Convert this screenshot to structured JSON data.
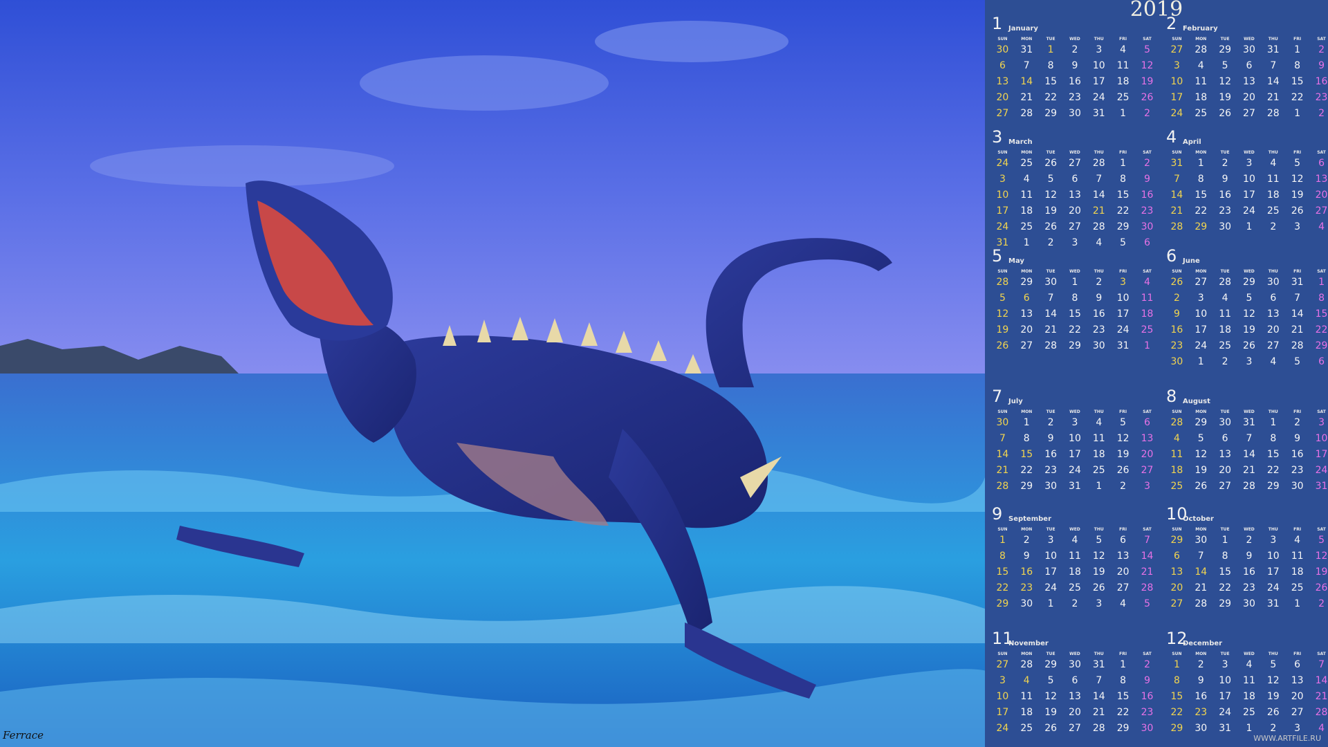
{
  "year": "2019",
  "weekdays": [
    "SUN",
    "MON",
    "TUE",
    "WED",
    "THU",
    "FRI",
    "SAT"
  ],
  "watermark": "WWW.ARTFILE.RU",
  "signature": "Ferrace",
  "colors": {
    "panel": "#2d4e94",
    "sunday": "#f2d54f",
    "saturday": "#e772e6",
    "text": "#f6f6f6"
  },
  "months": [
    {
      "num": "1",
      "name": "January",
      "weeks": [
        [
          "30",
          "31",
          "1",
          "2",
          "3",
          "4",
          "5"
        ],
        [
          "6",
          "7",
          "8",
          "9",
          "10",
          "11",
          "12"
        ],
        [
          "13",
          "14",
          "15",
          "16",
          "17",
          "18",
          "19"
        ],
        [
          "20",
          "21",
          "22",
          "23",
          "24",
          "25",
          "26"
        ],
        [
          "27",
          "28",
          "29",
          "30",
          "31",
          "1",
          "2"
        ]
      ],
      "holidays": [
        "0:2",
        "2:1"
      ]
    },
    {
      "num": "2",
      "name": "February",
      "weeks": [
        [
          "27",
          "28",
          "29",
          "30",
          "31",
          "1",
          "2"
        ],
        [
          "3",
          "4",
          "5",
          "6",
          "7",
          "8",
          "9"
        ],
        [
          "10",
          "11",
          "12",
          "13",
          "14",
          "15",
          "16"
        ],
        [
          "17",
          "18",
          "19",
          "20",
          "21",
          "22",
          "23"
        ],
        [
          "24",
          "25",
          "26",
          "27",
          "28",
          "1",
          "2"
        ]
      ],
      "holidays": []
    },
    {
      "num": "3",
      "name": "March",
      "weeks": [
        [
          "24",
          "25",
          "26",
          "27",
          "28",
          "1",
          "2"
        ],
        [
          "3",
          "4",
          "5",
          "6",
          "7",
          "8",
          "9"
        ],
        [
          "10",
          "11",
          "12",
          "13",
          "14",
          "15",
          "16"
        ],
        [
          "17",
          "18",
          "19",
          "20",
          "21",
          "22",
          "23"
        ],
        [
          "24",
          "25",
          "26",
          "27",
          "28",
          "29",
          "30"
        ],
        [
          "31",
          "1",
          "2",
          "3",
          "4",
          "5",
          "6"
        ]
      ],
      "holidays": [
        "3:4"
      ]
    },
    {
      "num": "4",
      "name": "April",
      "weeks": [
        [
          "31",
          "1",
          "2",
          "3",
          "4",
          "5",
          "6"
        ],
        [
          "7",
          "8",
          "9",
          "10",
          "11",
          "12",
          "13"
        ],
        [
          "14",
          "15",
          "16",
          "17",
          "18",
          "19",
          "20"
        ],
        [
          "21",
          "22",
          "23",
          "24",
          "25",
          "26",
          "27"
        ],
        [
          "28",
          "29",
          "30",
          "1",
          "2",
          "3",
          "4"
        ]
      ],
      "holidays": [
        "4:1"
      ]
    },
    {
      "num": "5",
      "name": "May",
      "weeks": [
        [
          "28",
          "29",
          "30",
          "1",
          "2",
          "3",
          "4"
        ],
        [
          "5",
          "6",
          "7",
          "8",
          "9",
          "10",
          "11"
        ],
        [
          "12",
          "13",
          "14",
          "15",
          "16",
          "17",
          "18"
        ],
        [
          "19",
          "20",
          "21",
          "22",
          "23",
          "24",
          "25"
        ],
        [
          "26",
          "27",
          "28",
          "29",
          "30",
          "31",
          "1"
        ]
      ],
      "holidays": [
        "0:5",
        "1:1"
      ]
    },
    {
      "num": "6",
      "name": "June",
      "weeks": [
        [
          "26",
          "27",
          "28",
          "29",
          "30",
          "31",
          "1"
        ],
        [
          "2",
          "3",
          "4",
          "5",
          "6",
          "7",
          "8"
        ],
        [
          "9",
          "10",
          "11",
          "12",
          "13",
          "14",
          "15"
        ],
        [
          "16",
          "17",
          "18",
          "19",
          "20",
          "21",
          "22"
        ],
        [
          "23",
          "24",
          "25",
          "26",
          "27",
          "28",
          "29"
        ],
        [
          "30",
          "1",
          "2",
          "3",
          "4",
          "5",
          "6"
        ]
      ],
      "holidays": []
    },
    {
      "num": "7",
      "name": "July",
      "weeks": [
        [
          "30",
          "1",
          "2",
          "3",
          "4",
          "5",
          "6"
        ],
        [
          "7",
          "8",
          "9",
          "10",
          "11",
          "12",
          "13"
        ],
        [
          "14",
          "15",
          "16",
          "17",
          "18",
          "19",
          "20"
        ],
        [
          "21",
          "22",
          "23",
          "24",
          "25",
          "26",
          "27"
        ],
        [
          "28",
          "29",
          "30",
          "31",
          "1",
          "2",
          "3"
        ]
      ],
      "holidays": [
        "2:1"
      ]
    },
    {
      "num": "8",
      "name": "August",
      "weeks": [
        [
          "28",
          "29",
          "30",
          "31",
          "1",
          "2",
          "3"
        ],
        [
          "4",
          "5",
          "6",
          "7",
          "8",
          "9",
          "10"
        ],
        [
          "11",
          "12",
          "13",
          "14",
          "15",
          "16",
          "17"
        ],
        [
          "18",
          "19",
          "20",
          "21",
          "22",
          "23",
          "24"
        ],
        [
          "25",
          "26",
          "27",
          "28",
          "29",
          "30",
          "31"
        ]
      ],
      "holidays": []
    },
    {
      "num": "9",
      "name": "September",
      "weeks": [
        [
          "1",
          "2",
          "3",
          "4",
          "5",
          "6",
          "7"
        ],
        [
          "8",
          "9",
          "10",
          "11",
          "12",
          "13",
          "14"
        ],
        [
          "15",
          "16",
          "17",
          "18",
          "19",
          "20",
          "21"
        ],
        [
          "22",
          "23",
          "24",
          "25",
          "26",
          "27",
          "28"
        ],
        [
          "29",
          "30",
          "1",
          "2",
          "3",
          "4",
          "5"
        ]
      ],
      "holidays": [
        "2:1",
        "3:1"
      ]
    },
    {
      "num": "10",
      "name": "October",
      "weeks": [
        [
          "29",
          "30",
          "1",
          "2",
          "3",
          "4",
          "5"
        ],
        [
          "6",
          "7",
          "8",
          "9",
          "10",
          "11",
          "12"
        ],
        [
          "13",
          "14",
          "15",
          "16",
          "17",
          "18",
          "19"
        ],
        [
          "20",
          "21",
          "22",
          "23",
          "24",
          "25",
          "26"
        ],
        [
          "27",
          "28",
          "29",
          "30",
          "31",
          "1",
          "2"
        ]
      ],
      "holidays": [
        "2:1"
      ]
    },
    {
      "num": "11",
      "name": "November",
      "weeks": [
        [
          "27",
          "28",
          "29",
          "30",
          "31",
          "1",
          "2"
        ],
        [
          "3",
          "4",
          "5",
          "6",
          "7",
          "8",
          "9"
        ],
        [
          "10",
          "11",
          "12",
          "13",
          "14",
          "15",
          "16"
        ],
        [
          "17",
          "18",
          "19",
          "20",
          "21",
          "22",
          "23"
        ],
        [
          "24",
          "25",
          "26",
          "27",
          "28",
          "29",
          "30"
        ]
      ],
      "holidays": [
        "1:1"
      ]
    },
    {
      "num": "12",
      "name": "December",
      "weeks": [
        [
          "1",
          "2",
          "3",
          "4",
          "5",
          "6",
          "7"
        ],
        [
          "8",
          "9",
          "10",
          "11",
          "12",
          "13",
          "14"
        ],
        [
          "15",
          "16",
          "17",
          "18",
          "19",
          "20",
          "21"
        ],
        [
          "22",
          "23",
          "24",
          "25",
          "26",
          "27",
          "28"
        ],
        [
          "29",
          "30",
          "31",
          "1",
          "2",
          "3",
          "4"
        ]
      ],
      "holidays": [
        "3:1"
      ]
    }
  ]
}
